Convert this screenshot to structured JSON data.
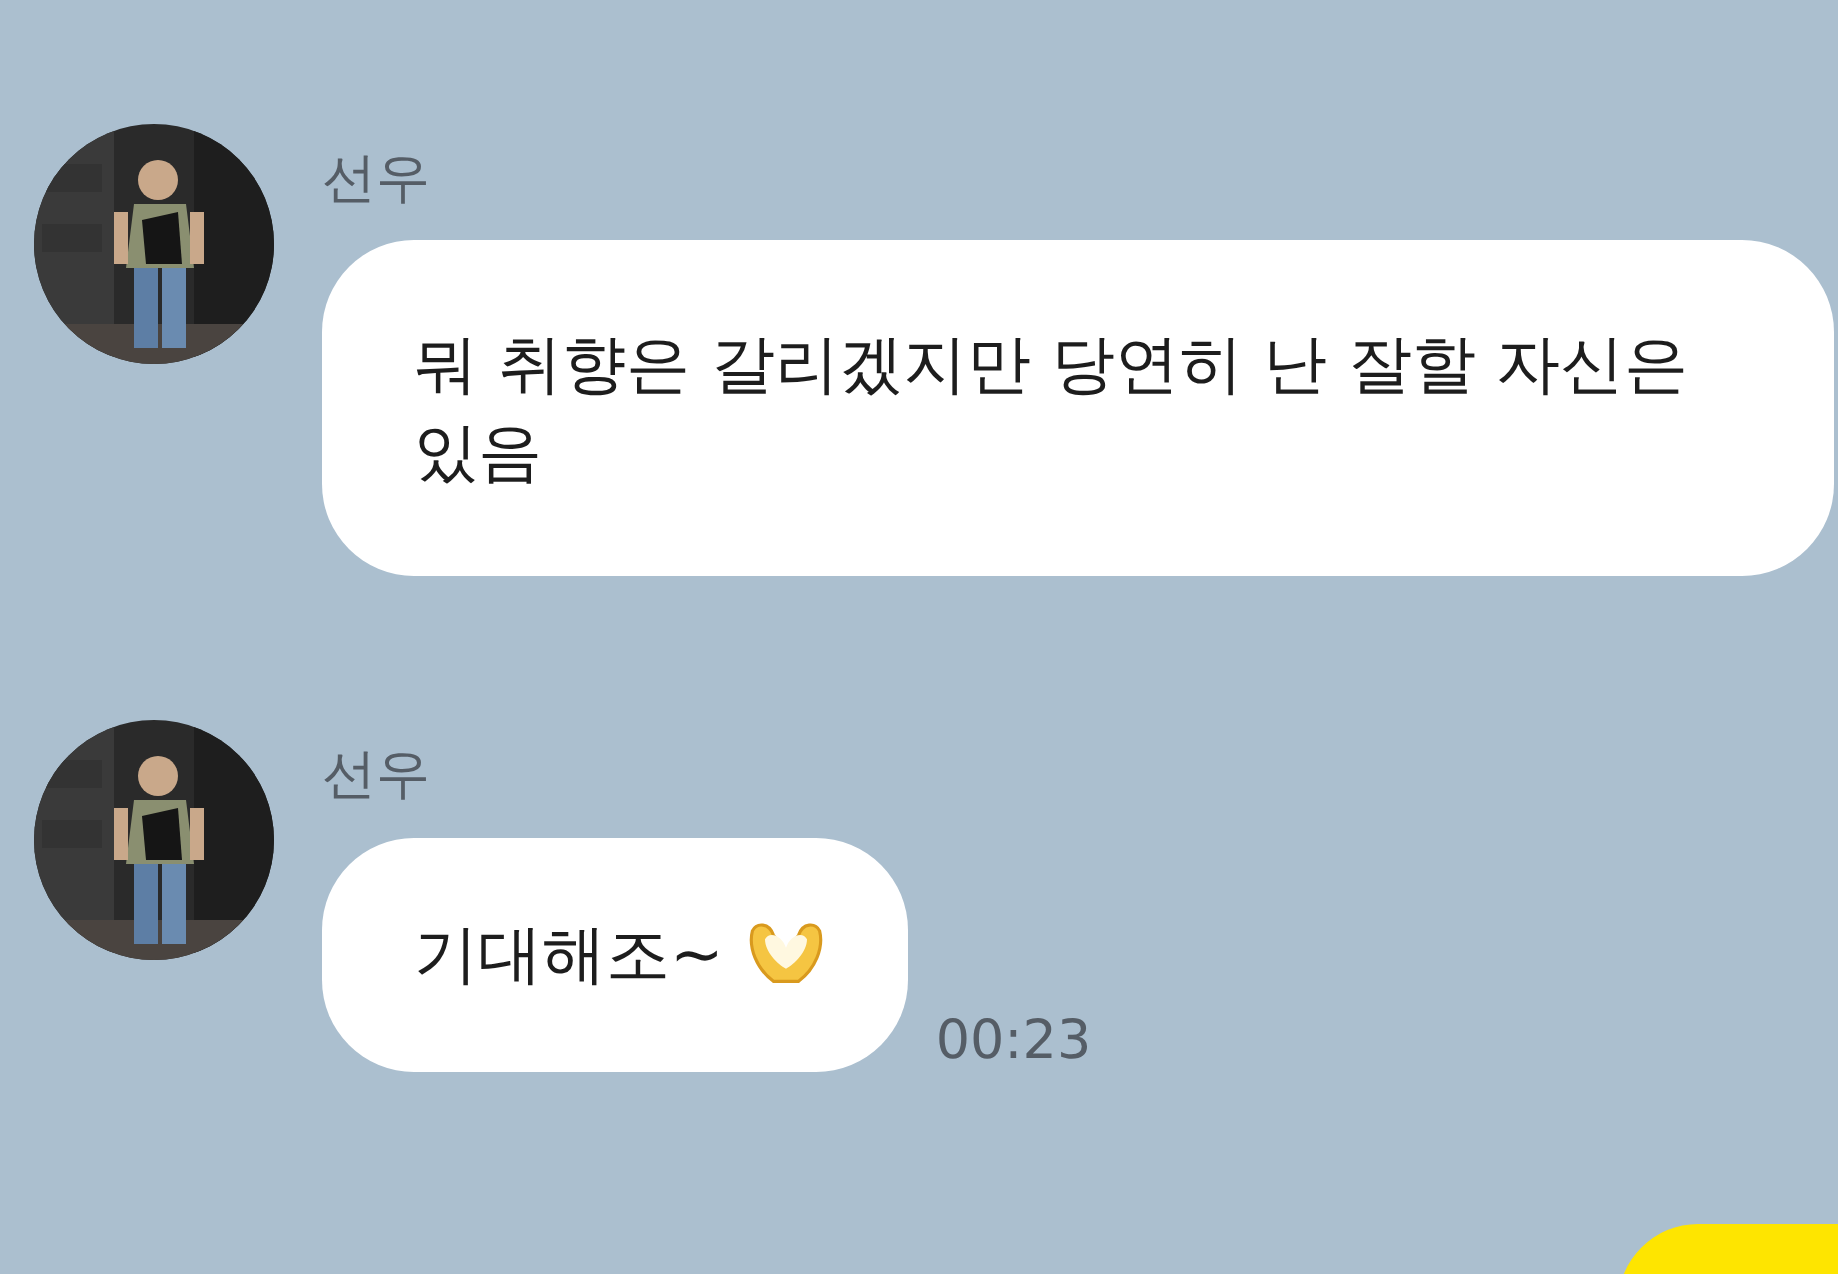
{
  "messages": [
    {
      "sender": "선우",
      "text": "뭐 취향은 갈리겠지만 당연히 난 잘할 자신은 있음",
      "emoji": false
    },
    {
      "sender": "선우",
      "text": "기대해조~",
      "emoji": true,
      "time": "00:23"
    }
  ]
}
